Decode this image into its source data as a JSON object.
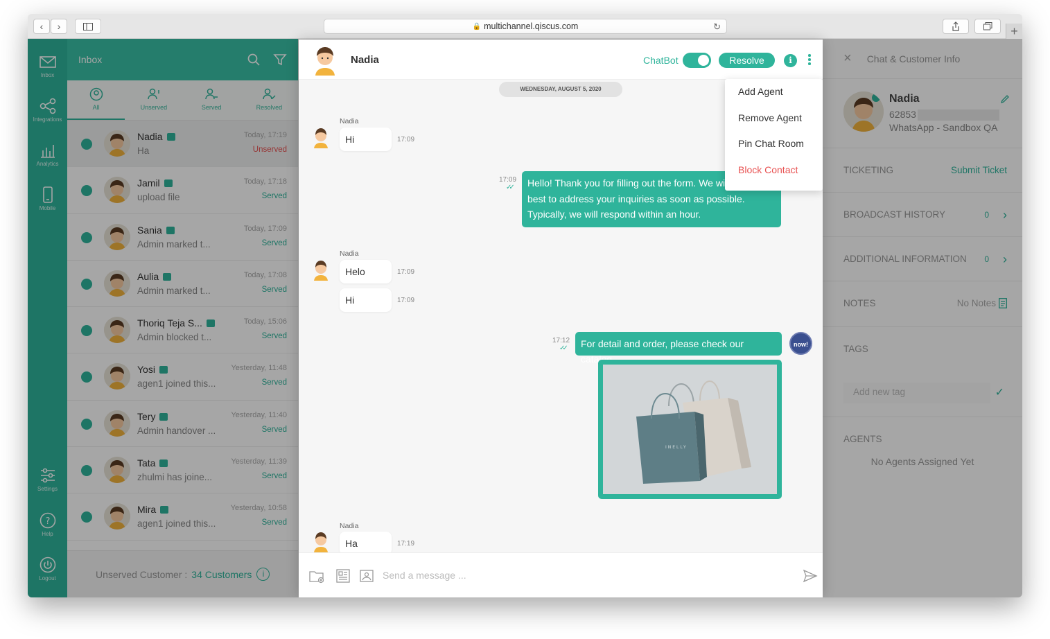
{
  "browser": {
    "url": "multichannel.qiscus.com"
  },
  "nav": [
    {
      "label": "Inbox",
      "icon": "mail-icon"
    },
    {
      "label": "Integrations",
      "icon": "share-icon"
    },
    {
      "label": "Analytics",
      "icon": "chart-icon"
    },
    {
      "label": "Mobile",
      "icon": "phone-icon"
    },
    {
      "label": "Settings",
      "icon": "sliders-icon"
    },
    {
      "label": "Help",
      "icon": "help-icon"
    },
    {
      "label": "Logout",
      "icon": "power-icon"
    }
  ],
  "inbox": {
    "title": "Inbox",
    "tabs": [
      "All",
      "Unserved",
      "Served",
      "Resolved"
    ],
    "rows": [
      {
        "name": "Nadia",
        "preview": "Ha",
        "time": "Today, 17:19",
        "status": "Unserved"
      },
      {
        "name": "Jamil",
        "preview": "upload file",
        "time": "Today, 17:18",
        "status": "Served"
      },
      {
        "name": "Sania",
        "preview": "Admin marked t...",
        "time": "Today, 17:09",
        "status": "Served"
      },
      {
        "name": "Aulia",
        "preview": "Admin marked t...",
        "time": "Today, 17:08",
        "status": "Served"
      },
      {
        "name": "Thoriq Teja S...",
        "preview": "Admin blocked t...",
        "time": "Today, 15:06",
        "status": "Served"
      },
      {
        "name": "Yosi",
        "preview": "agen1 joined this...",
        "time": "Yesterday, 11:48",
        "status": "Served"
      },
      {
        "name": "Tery",
        "preview": "Admin handover ...",
        "time": "Yesterday, 11:40",
        "status": "Served"
      },
      {
        "name": "Tata",
        "preview": "zhulmi has joine...",
        "time": "Yesterday, 11:39",
        "status": "Served"
      },
      {
        "name": "Mira",
        "preview": "agen1 joined this...",
        "time": "Yesterday, 10:58",
        "status": "Served"
      }
    ],
    "footer_label": "Unserved Customer :",
    "footer_count": "34 Customers"
  },
  "chat": {
    "name": "Nadia",
    "chatbot_label": "ChatBot",
    "chatbot_on": true,
    "resolve_label": "Resolve",
    "menu": [
      "Add Agent",
      "Remove Agent",
      "Pin Chat Room",
      "Block Contact"
    ],
    "date": "WEDNESDAY, AUGUST 5, 2020",
    "messages": {
      "m1": {
        "sender": "Nadia",
        "text": "Hi",
        "time": "17:09"
      },
      "m2": {
        "text": "Hello! Thank you for filling out the form. We wi",
        "line2": "best to address your inquiries as soon as possible.",
        "line3": "Typically, we will respond within an hour.",
        "time": "17:09"
      },
      "m3": {
        "sender": "Nadia",
        "text": "Helo",
        "time": "17:09"
      },
      "m4": {
        "text": "Hi",
        "time": "17:09"
      },
      "m5": {
        "text": "For detail and order, please check our catalog",
        "time": "17:12"
      },
      "m6": {
        "brand": "INELLY"
      },
      "m7": {
        "sender": "Nadia",
        "text": "Ha",
        "time": "17:19"
      }
    },
    "bot_avatar_text": "now!",
    "composer_placeholder": "Send a message ..."
  },
  "info": {
    "title": "Chat & Customer Info",
    "name": "Nadia",
    "phone": "62853",
    "channel": "WhatsApp - Sandbox QA",
    "ticketing": "TICKETING",
    "submit_ticket": "Submit Ticket",
    "broadcast": "BROADCAST HISTORY",
    "broadcast_count": "0",
    "additional": "ADDITIONAL INFORMATION",
    "additional_count": "0",
    "notes": "NOTES",
    "no_notes": "No Notes",
    "tags": "TAGS",
    "tag_placeholder": "Add new tag",
    "agents": "AGENTS",
    "no_agents": "No Agents Assigned Yet"
  },
  "colors": {
    "accent": "#2fb49b",
    "danger": "#e85252"
  }
}
